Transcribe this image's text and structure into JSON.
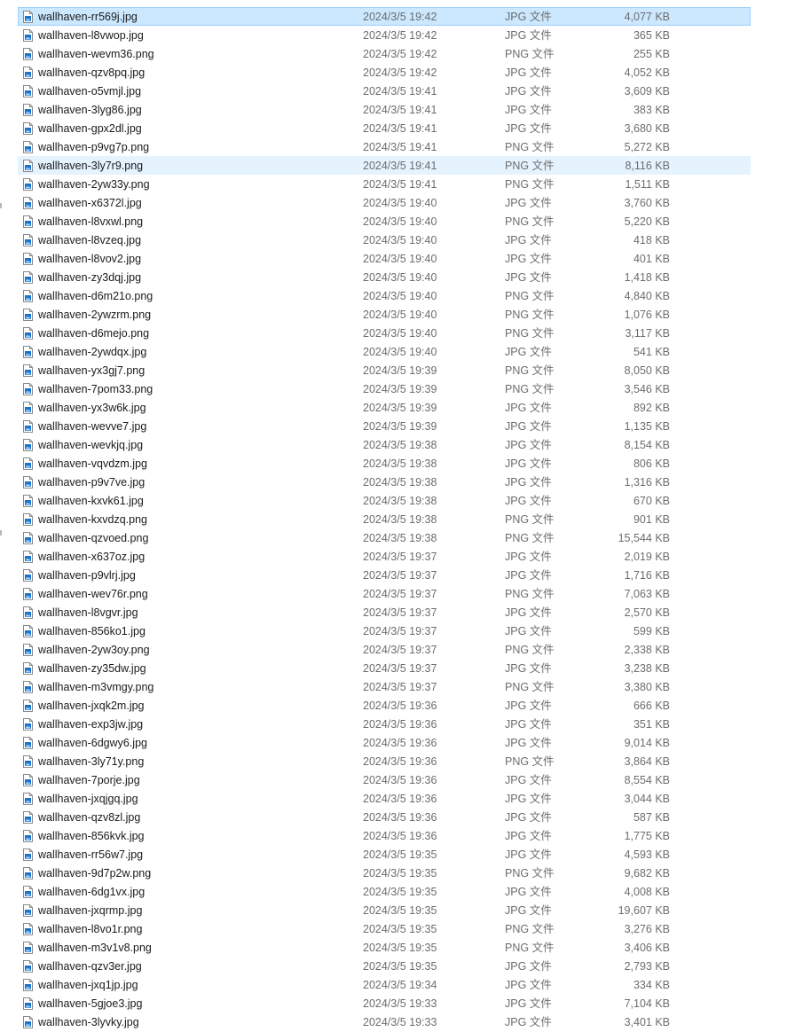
{
  "files": [
    {
      "name": "wallhaven-rr569j.jpg",
      "date": "2024/3/5 19:42",
      "type": "JPG 文件",
      "size": "4,077 KB"
    },
    {
      "name": "wallhaven-l8vwop.jpg",
      "date": "2024/3/5 19:42",
      "type": "JPG 文件",
      "size": "365 KB"
    },
    {
      "name": "wallhaven-wevm36.png",
      "date": "2024/3/5 19:42",
      "type": "PNG 文件",
      "size": "255 KB"
    },
    {
      "name": "wallhaven-qzv8pq.jpg",
      "date": "2024/3/5 19:42",
      "type": "JPG 文件",
      "size": "4,052 KB"
    },
    {
      "name": "wallhaven-o5vmjl.jpg",
      "date": "2024/3/5 19:41",
      "type": "JPG 文件",
      "size": "3,609 KB"
    },
    {
      "name": "wallhaven-3lyg86.jpg",
      "date": "2024/3/5 19:41",
      "type": "JPG 文件",
      "size": "383 KB"
    },
    {
      "name": "wallhaven-gpx2dl.jpg",
      "date": "2024/3/5 19:41",
      "type": "JPG 文件",
      "size": "3,680 KB"
    },
    {
      "name": "wallhaven-p9vg7p.png",
      "date": "2024/3/5 19:41",
      "type": "PNG 文件",
      "size": "5,272 KB"
    },
    {
      "name": "wallhaven-3ly7r9.png",
      "date": "2024/3/5 19:41",
      "type": "PNG 文件",
      "size": "8,116 KB"
    },
    {
      "name": "wallhaven-2yw33y.png",
      "date": "2024/3/5 19:41",
      "type": "PNG 文件",
      "size": "1,511 KB"
    },
    {
      "name": "wallhaven-x6372l.jpg",
      "date": "2024/3/5 19:40",
      "type": "JPG 文件",
      "size": "3,760 KB"
    },
    {
      "name": "wallhaven-l8vxwl.png",
      "date": "2024/3/5 19:40",
      "type": "PNG 文件",
      "size": "5,220 KB"
    },
    {
      "name": "wallhaven-l8vzeq.jpg",
      "date": "2024/3/5 19:40",
      "type": "JPG 文件",
      "size": "418 KB"
    },
    {
      "name": "wallhaven-l8vov2.jpg",
      "date": "2024/3/5 19:40",
      "type": "JPG 文件",
      "size": "401 KB"
    },
    {
      "name": "wallhaven-zy3dqj.jpg",
      "date": "2024/3/5 19:40",
      "type": "JPG 文件",
      "size": "1,418 KB"
    },
    {
      "name": "wallhaven-d6m21o.png",
      "date": "2024/3/5 19:40",
      "type": "PNG 文件",
      "size": "4,840 KB"
    },
    {
      "name": "wallhaven-2ywzrm.png",
      "date": "2024/3/5 19:40",
      "type": "PNG 文件",
      "size": "1,076 KB"
    },
    {
      "name": "wallhaven-d6mejo.png",
      "date": "2024/3/5 19:40",
      "type": "PNG 文件",
      "size": "3,117 KB"
    },
    {
      "name": "wallhaven-2ywdqx.jpg",
      "date": "2024/3/5 19:40",
      "type": "JPG 文件",
      "size": "541 KB"
    },
    {
      "name": "wallhaven-yx3gj7.png",
      "date": "2024/3/5 19:39",
      "type": "PNG 文件",
      "size": "8,050 KB"
    },
    {
      "name": "wallhaven-7pom33.png",
      "date": "2024/3/5 19:39",
      "type": "PNG 文件",
      "size": "3,546 KB"
    },
    {
      "name": "wallhaven-yx3w6k.jpg",
      "date": "2024/3/5 19:39",
      "type": "JPG 文件",
      "size": "892 KB"
    },
    {
      "name": "wallhaven-wevve7.jpg",
      "date": "2024/3/5 19:39",
      "type": "JPG 文件",
      "size": "1,135 KB"
    },
    {
      "name": "wallhaven-wevkjq.jpg",
      "date": "2024/3/5 19:38",
      "type": "JPG 文件",
      "size": "8,154 KB"
    },
    {
      "name": "wallhaven-vqvdzm.jpg",
      "date": "2024/3/5 19:38",
      "type": "JPG 文件",
      "size": "806 KB"
    },
    {
      "name": "wallhaven-p9v7ve.jpg",
      "date": "2024/3/5 19:38",
      "type": "JPG 文件",
      "size": "1,316 KB"
    },
    {
      "name": "wallhaven-kxvk61.jpg",
      "date": "2024/3/5 19:38",
      "type": "JPG 文件",
      "size": "670 KB"
    },
    {
      "name": "wallhaven-kxvdzq.png",
      "date": "2024/3/5 19:38",
      "type": "PNG 文件",
      "size": "901 KB"
    },
    {
      "name": "wallhaven-qzvoed.png",
      "date": "2024/3/5 19:38",
      "type": "PNG 文件",
      "size": "15,544 KB"
    },
    {
      "name": "wallhaven-x637oz.jpg",
      "date": "2024/3/5 19:37",
      "type": "JPG 文件",
      "size": "2,019 KB"
    },
    {
      "name": "wallhaven-p9vlrj.jpg",
      "date": "2024/3/5 19:37",
      "type": "JPG 文件",
      "size": "1,716 KB"
    },
    {
      "name": "wallhaven-wev76r.png",
      "date": "2024/3/5 19:37",
      "type": "PNG 文件",
      "size": "7,063 KB"
    },
    {
      "name": "wallhaven-l8vgvr.jpg",
      "date": "2024/3/5 19:37",
      "type": "JPG 文件",
      "size": "2,570 KB"
    },
    {
      "name": "wallhaven-856ko1.jpg",
      "date": "2024/3/5 19:37",
      "type": "JPG 文件",
      "size": "599 KB"
    },
    {
      "name": "wallhaven-2yw3oy.png",
      "date": "2024/3/5 19:37",
      "type": "PNG 文件",
      "size": "2,338 KB"
    },
    {
      "name": "wallhaven-zy35dw.jpg",
      "date": "2024/3/5 19:37",
      "type": "JPG 文件",
      "size": "3,238 KB"
    },
    {
      "name": "wallhaven-m3vmgy.png",
      "date": "2024/3/5 19:37",
      "type": "PNG 文件",
      "size": "3,380 KB"
    },
    {
      "name": "wallhaven-jxqk2m.jpg",
      "date": "2024/3/5 19:36",
      "type": "JPG 文件",
      "size": "666 KB"
    },
    {
      "name": "wallhaven-exp3jw.jpg",
      "date": "2024/3/5 19:36",
      "type": "JPG 文件",
      "size": "351 KB"
    },
    {
      "name": "wallhaven-6dgwy6.jpg",
      "date": "2024/3/5 19:36",
      "type": "JPG 文件",
      "size": "9,014 KB"
    },
    {
      "name": "wallhaven-3ly71y.png",
      "date": "2024/3/5 19:36",
      "type": "PNG 文件",
      "size": "3,864 KB"
    },
    {
      "name": "wallhaven-7porje.jpg",
      "date": "2024/3/5 19:36",
      "type": "JPG 文件",
      "size": "8,554 KB"
    },
    {
      "name": "wallhaven-jxqjgq.jpg",
      "date": "2024/3/5 19:36",
      "type": "JPG 文件",
      "size": "3,044 KB"
    },
    {
      "name": "wallhaven-qzv8zl.jpg",
      "date": "2024/3/5 19:36",
      "type": "JPG 文件",
      "size": "587 KB"
    },
    {
      "name": "wallhaven-856kvk.jpg",
      "date": "2024/3/5 19:36",
      "type": "JPG 文件",
      "size": "1,775 KB"
    },
    {
      "name": "wallhaven-rr56w7.jpg",
      "date": "2024/3/5 19:35",
      "type": "JPG 文件",
      "size": "4,593 KB"
    },
    {
      "name": "wallhaven-9d7p2w.png",
      "date": "2024/3/5 19:35",
      "type": "PNG 文件",
      "size": "9,682 KB"
    },
    {
      "name": "wallhaven-6dg1vx.jpg",
      "date": "2024/3/5 19:35",
      "type": "JPG 文件",
      "size": "4,008 KB"
    },
    {
      "name": "wallhaven-jxqrmp.jpg",
      "date": "2024/3/5 19:35",
      "type": "JPG 文件",
      "size": "19,607 KB"
    },
    {
      "name": "wallhaven-l8vo1r.png",
      "date": "2024/3/5 19:35",
      "type": "PNG 文件",
      "size": "3,276 KB"
    },
    {
      "name": "wallhaven-m3v1v8.png",
      "date": "2024/3/5 19:35",
      "type": "PNG 文件",
      "size": "3,406 KB"
    },
    {
      "name": "wallhaven-qzv3er.jpg",
      "date": "2024/3/5 19:35",
      "type": "JPG 文件",
      "size": "2,793 KB"
    },
    {
      "name": "wallhaven-jxq1jp.jpg",
      "date": "2024/3/5 19:34",
      "type": "JPG 文件",
      "size": "334 KB"
    },
    {
      "name": "wallhaven-5gjoe3.jpg",
      "date": "2024/3/5 19:33",
      "type": "JPG 文件",
      "size": "7,104 KB"
    },
    {
      "name": "wallhaven-3lyvky.jpg",
      "date": "2024/3/5 19:33",
      "type": "JPG 文件",
      "size": "3,401 KB"
    }
  ],
  "selected_index": 0,
  "hover_index": 8,
  "icon": "image-file-icon",
  "colors": {
    "selected_bg": "#cce8ff",
    "selected_border": "#99d1ff",
    "hover_bg": "#e5f3ff",
    "icon_blue": "#1e73c8"
  }
}
